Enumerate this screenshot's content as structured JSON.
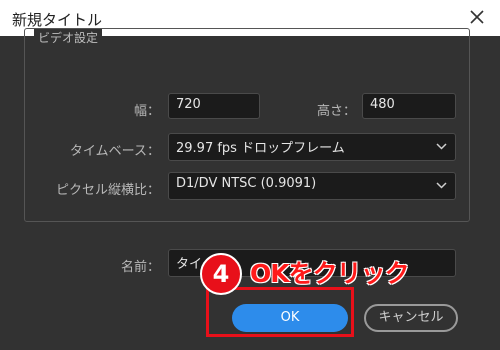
{
  "window": {
    "title": "新規タイトル",
    "close_icon": "close-icon"
  },
  "video_settings": {
    "legend": "ビデオ設定",
    "width_label": "幅：",
    "width_value": "720",
    "height_label": "高さ：",
    "height_value": "480",
    "timebase_label": "タイムベース：",
    "timebase_value": "29.97 fps ドロップフレーム",
    "pixel_aspect_label": "ピクセル縦横比：",
    "pixel_aspect_value": "D1/DV NTSC (0.9091)"
  },
  "name": {
    "label": "名前：",
    "value": "タイ...01"
  },
  "buttons": {
    "ok": "OK",
    "cancel": "キャンセル"
  },
  "annotation": {
    "step_number": "4",
    "instruction": "OKをクリック",
    "color": "#e8101a"
  },
  "colors": {
    "accent": "#2d8ceb",
    "background": "#323232"
  }
}
